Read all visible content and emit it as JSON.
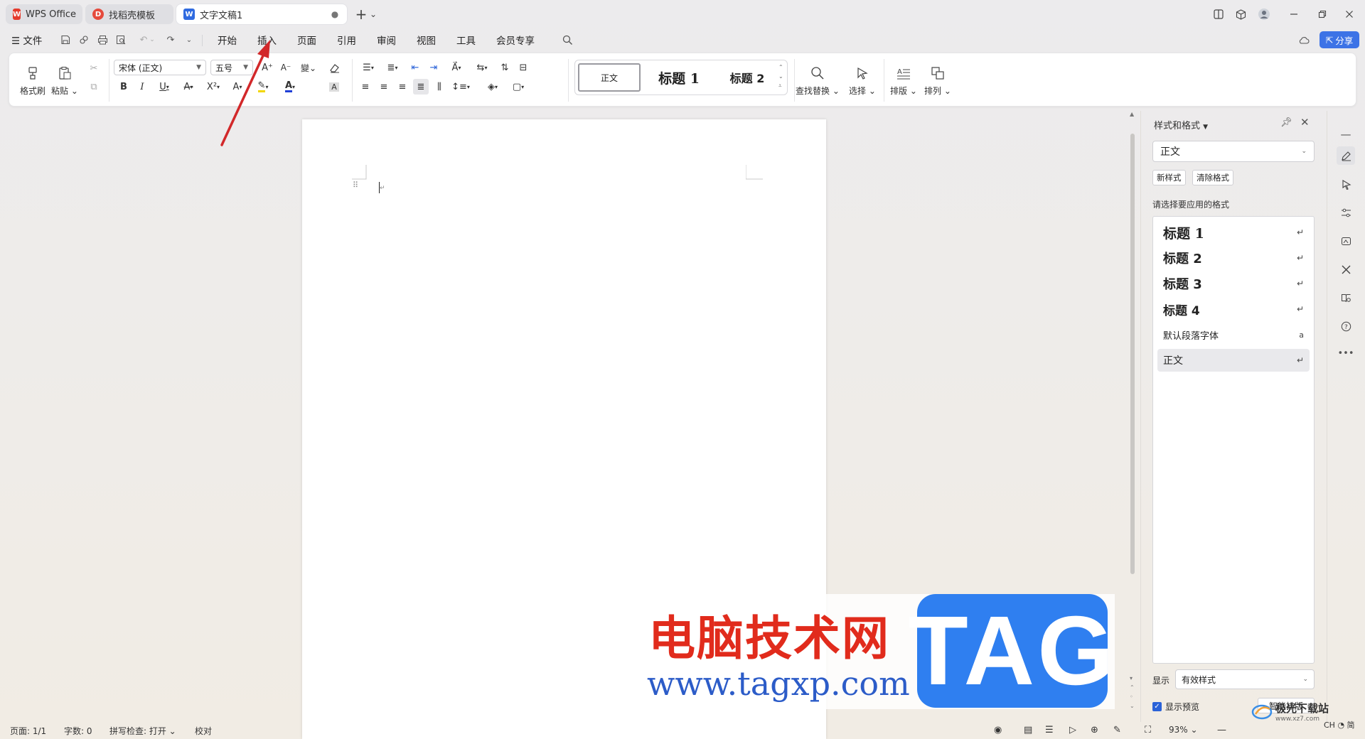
{
  "titlebar": {
    "tabs": [
      {
        "label": "WPS Office",
        "icon": "wps-logo-icon"
      },
      {
        "label": "找稻壳模板",
        "icon": "docer-logo-icon"
      },
      {
        "label": "文字文稿1",
        "icon": "writer-logo-icon",
        "close": "●"
      }
    ],
    "new_tab": "+",
    "new_tab_menu": "⌄"
  },
  "menubar": {
    "file": "文件",
    "tabs": [
      "开始",
      "插入",
      "页面",
      "引用",
      "审阅",
      "视图",
      "工具",
      "会员专享"
    ],
    "active_tab": "开始",
    "share": "分享"
  },
  "ribbon": {
    "format_painter": "格式刷",
    "paste": "粘贴",
    "font_name": "宋体 (正文)",
    "font_size": "五号",
    "styles": [
      "正文",
      "标题 1",
      "标题 2"
    ],
    "find_replace": "查找替换",
    "select": "选择",
    "layout": "排版",
    "arrange": "排列"
  },
  "styles_pane": {
    "title": "样式和格式",
    "current_style": "正文",
    "new_style": "新样式",
    "clear_format": "清除格式",
    "apply_label": "请选择要应用的格式",
    "items": [
      {
        "label": "标题 1",
        "mark": "↵"
      },
      {
        "label": "标题 2",
        "mark": "↵"
      },
      {
        "label": "标题 3",
        "mark": "↵"
      },
      {
        "label": "标题 4",
        "mark": "↵"
      },
      {
        "label": "默认段落字体",
        "mark": "a"
      },
      {
        "label": "正文",
        "mark": "↵"
      }
    ],
    "show_label": "显示",
    "show_value": "有效样式",
    "preview_label": "显示预览",
    "smart_layout": "智能排版"
  },
  "statusbar": {
    "page": "页面: 1/1",
    "words": "字数: 0",
    "spell": "拼写检查: 打开",
    "proof": "校对",
    "zoom": "93%"
  },
  "watermark": {
    "site_cn": "电脑技术网",
    "site_url": "www.tagxp.com",
    "tag": "TAG",
    "corner": "极光下载站",
    "corner_url": "www.xz7.com",
    "ime": "CH ◔ 简"
  },
  "colors": {
    "accent": "#2a62d8",
    "share_bg": "#3d73e6",
    "annotation_arrow": "#d2282a",
    "watermark_red": "#e12b1c",
    "watermark_blue": "#2f7ff0"
  }
}
